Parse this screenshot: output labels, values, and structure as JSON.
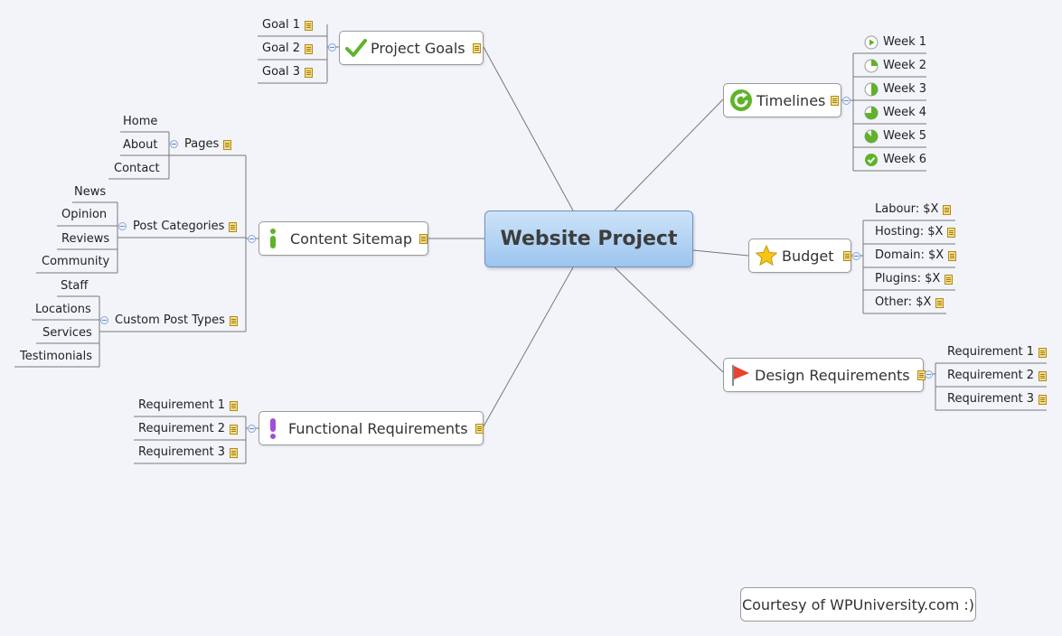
{
  "central": "Website Project",
  "topics": {
    "project_goals": {
      "label": "Project Goals",
      "icon": "check-icon",
      "children": [
        "Goal 1",
        "Goal 2",
        "Goal 3"
      ]
    },
    "content_sitemap": {
      "label": "Content Sitemap",
      "icon": "info-icon",
      "pages": {
        "label": "Pages",
        "children": [
          "Home",
          "About",
          "Contact"
        ]
      },
      "post_categories": {
        "label": "Post Categories",
        "children": [
          "News",
          "Opinion",
          "Reviews",
          "Community"
        ]
      },
      "custom_post_types": {
        "label": "Custom Post Types",
        "children": [
          "Staff",
          "Locations",
          "Services",
          "Testimonials"
        ]
      }
    },
    "functional_requirements": {
      "label": "Functional Requirements",
      "icon": "exclamation-icon",
      "children": [
        "Requirement 1",
        "Requirement 2",
        "Requirement 3"
      ]
    },
    "timelines": {
      "label": "Timelines",
      "icon": "refresh-icon",
      "children": [
        "Week 1",
        "Week 2",
        "Week 3",
        "Week 4",
        "Week 5",
        "Week 6"
      ],
      "progress": [
        0,
        0.25,
        0.5,
        0.75,
        0.875,
        1
      ]
    },
    "budget": {
      "label": "Budget",
      "icon": "star-icon",
      "children": [
        "Labour: $X",
        "Hosting: $X",
        "Domain: $X",
        "Plugins: $X",
        "Other: $X"
      ]
    },
    "design_requirements": {
      "label": "Design Requirements",
      "icon": "flag-icon",
      "children": [
        "Requirement 1",
        "Requirement 2",
        "Requirement 3"
      ]
    }
  },
  "footer": "Courtesy of WPUniversity.com :)",
  "colors": {
    "central_top": "#cde3f8",
    "central_bottom": "#9cc5ef",
    "line": "#7a7a7a",
    "green": "#5fb32a"
  }
}
